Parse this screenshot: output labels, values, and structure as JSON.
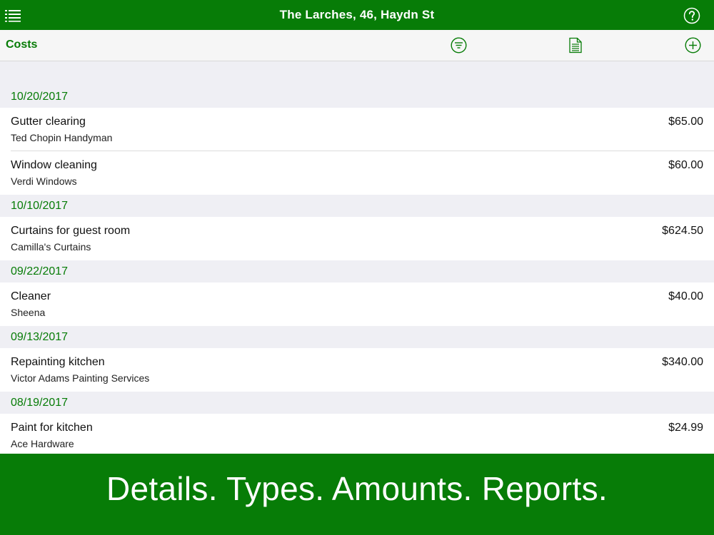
{
  "header": {
    "title": "The Larches, 46, Haydn St",
    "menu_icon": "list-icon",
    "help_icon": "question-circle-icon"
  },
  "toolbar": {
    "section_title": "Costs",
    "filter_icon": "filter-icon",
    "report_icon": "document-icon",
    "add_icon": "add-circle-icon"
  },
  "groups": [
    {
      "date": "10/20/2017",
      "items": [
        {
          "name": "Gutter clearing",
          "vendor": "Ted Chopin Handyman",
          "amount": "$65.00"
        },
        {
          "name": "Window cleaning",
          "vendor": "Verdi Windows",
          "amount": "$60.00"
        }
      ]
    },
    {
      "date": "10/10/2017",
      "items": [
        {
          "name": "Curtains for guest room",
          "vendor": "Camilla's Curtains",
          "amount": "$624.50"
        }
      ]
    },
    {
      "date": "09/22/2017",
      "items": [
        {
          "name": "Cleaner",
          "vendor": "Sheena",
          "amount": "$40.00"
        }
      ]
    },
    {
      "date": "09/13/2017",
      "items": [
        {
          "name": "Repainting kitchen",
          "vendor": "Victor Adams Painting Services",
          "amount": "$340.00"
        }
      ]
    },
    {
      "date": "08/19/2017",
      "items": [
        {
          "name": "Paint for kitchen",
          "vendor": "Ace Hardware",
          "amount": "$24.99"
        }
      ]
    }
  ],
  "banner": {
    "tagline": "Details. Types. Amounts. Reports."
  },
  "colors": {
    "brand_green": "#077c07",
    "section_bg": "#efeff4"
  }
}
